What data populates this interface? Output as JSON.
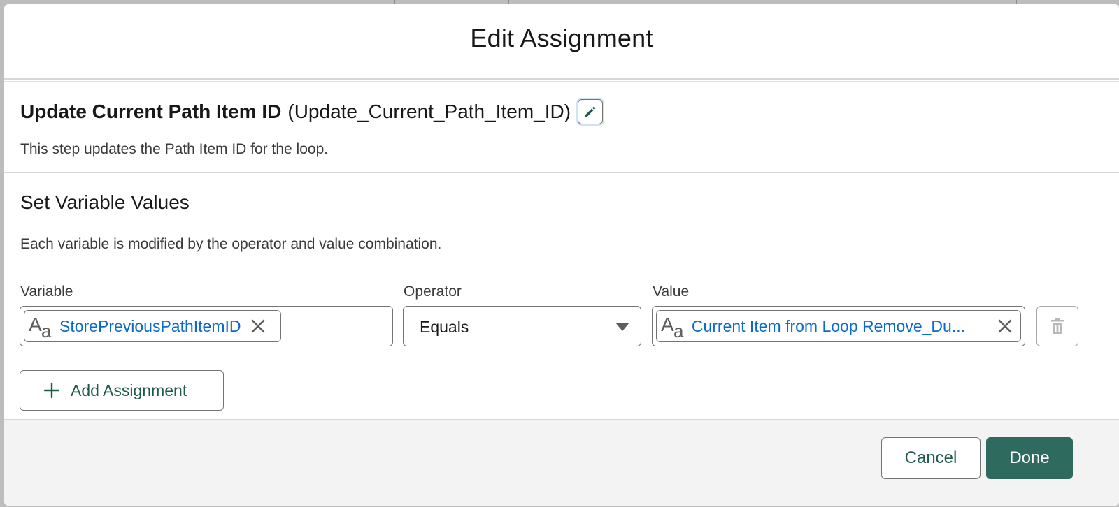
{
  "modal": {
    "title": "Edit Assignment"
  },
  "element": {
    "label": "Update Current Path Item ID",
    "api_name": "(Update_Current_Path_Item_ID)",
    "description": "This step updates the Path Item ID for the loop.",
    "edit_icon": "pencil-icon"
  },
  "variables_section": {
    "heading": "Set Variable Values",
    "description": "Each variable is modified by the operator and value combination.",
    "columns": {
      "variable": "Variable",
      "operator": "Operator",
      "value": "Value"
    },
    "rows": [
      {
        "variable": "StorePreviousPathItemID",
        "operator": "Equals",
        "value": "Current Item from Loop Remove_Du..."
      }
    ],
    "text_type_icon": {
      "big": "A",
      "small": "a"
    },
    "add_label": "Add Assignment"
  },
  "footer": {
    "cancel_label": "Cancel",
    "done_label": "Done"
  },
  "colors": {
    "brand": "#2e6b5e",
    "link": "#0b6bcb"
  }
}
